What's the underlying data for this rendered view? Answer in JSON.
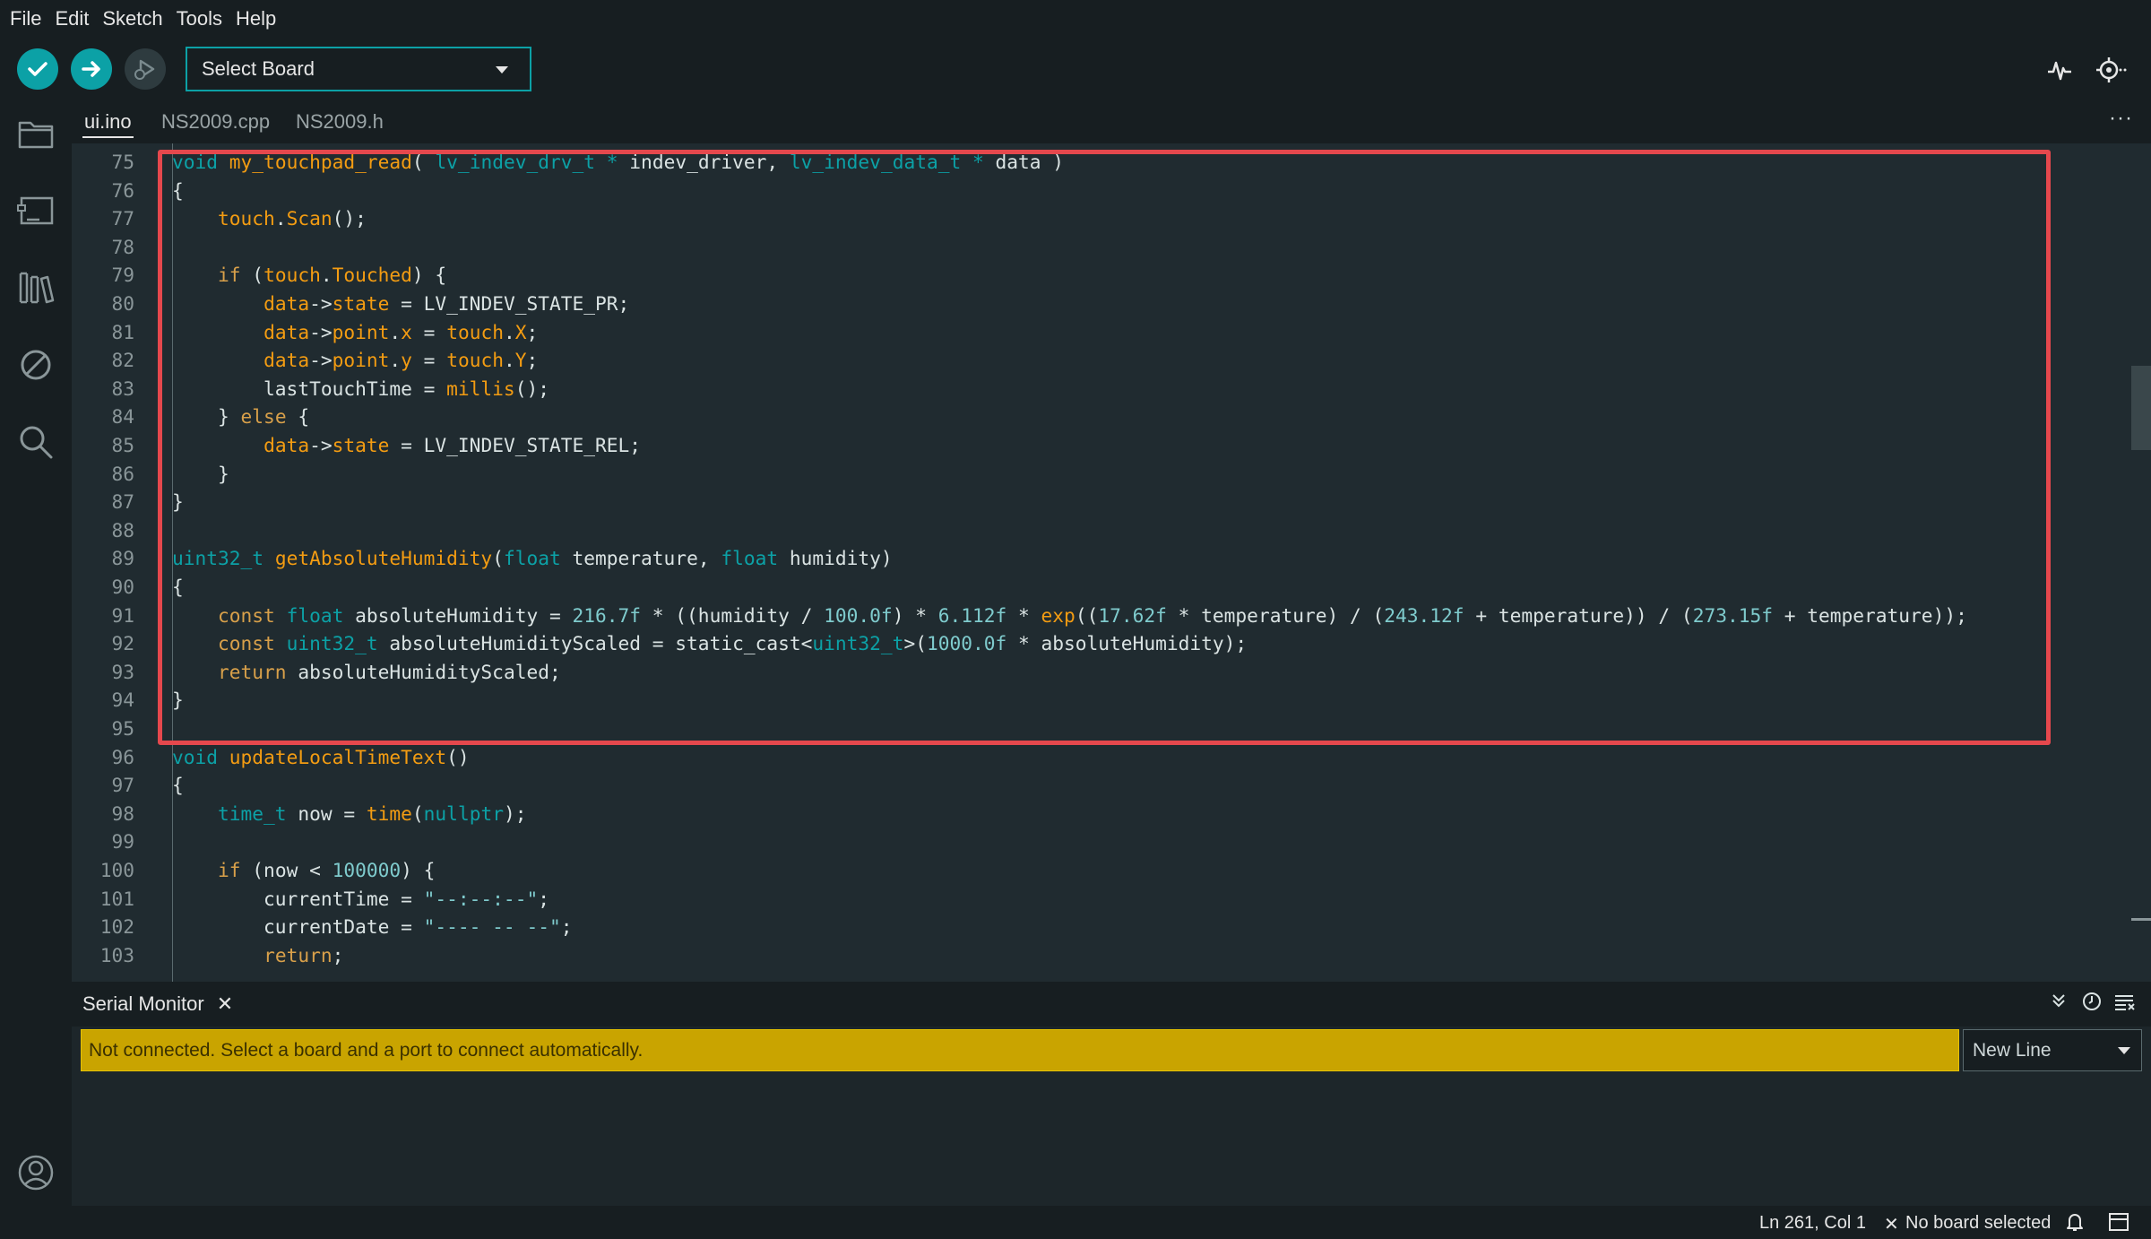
{
  "menu": [
    "File",
    "Edit",
    "Sketch",
    "Tools",
    "Help"
  ],
  "toolbar": {
    "board_select": "Select Board"
  },
  "tabs": [
    {
      "label": "ui.ino",
      "active": true
    },
    {
      "label": "NS2009.cpp",
      "active": false
    },
    {
      "label": "NS2009.h",
      "active": false
    }
  ],
  "tabs_more": "···",
  "editor": {
    "line_numbers": [
      "75",
      "76",
      "77",
      "78",
      "79",
      "80",
      "81",
      "82",
      "83",
      "84",
      "85",
      "86",
      "87",
      "88",
      "89",
      "90",
      "91",
      "92",
      "93",
      "94",
      "95",
      "96",
      "97",
      "98",
      "99",
      "100",
      "101",
      "102",
      "103"
    ],
    "lines": [
      "void my_touchpad_read( lv_indev_drv_t * indev_driver, lv_indev_data_t * data )",
      "{",
      "    touch.Scan();",
      "",
      "    if (touch.Touched) {",
      "        data->state = LV_INDEV_STATE_PR;",
      "        data->point.x = touch.X;",
      "        data->point.y = touch.Y;",
      "        lastTouchTime = millis();",
      "    } else {",
      "        data->state = LV_INDEV_STATE_REL;",
      "    }",
      "}",
      "",
      "uint32_t getAbsoluteHumidity(float temperature, float humidity)",
      "{",
      "    const float absoluteHumidity = 216.7f * ((humidity / 100.0f) * 6.112f * exp((17.62f * temperature) / (243.12f + temperature)) / (273.15f + temperature));",
      "    const uint32_t absoluteHumidityScaled = static_cast<uint32_t>(1000.0f * absoluteHumidity);",
      "    return absoluteHumidityScaled;",
      "}",
      "",
      "void updateLocalTimeText()",
      "{",
      "    time_t now = time(nullptr);",
      "",
      "    if (now < 100000) {",
      "        currentTime = \"--:--:--\";",
      "        currentDate = \"---- -- --\";",
      "        return;"
    ]
  },
  "serial_monitor": {
    "tab_label": "Serial Monitor",
    "close_label": "✕",
    "warning": "Not connected. Select a board and a port to connect automatically.",
    "line_ending": "New Line"
  },
  "status": {
    "position": "Ln 261, Col 1",
    "board": "No board selected",
    "board_prefix": "✕"
  },
  "colors": {
    "accent": "#0ca1a6",
    "highlight_box": "#e5484d",
    "warning_bar": "#c9a400"
  }
}
